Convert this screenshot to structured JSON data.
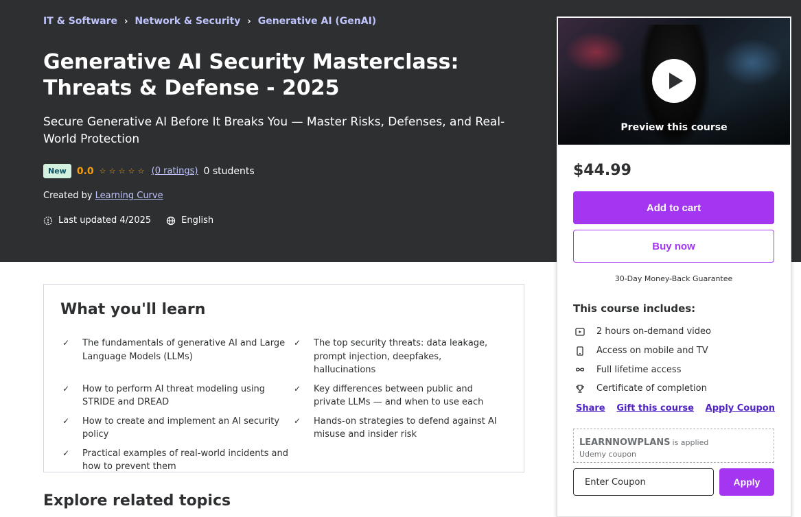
{
  "breadcrumb": [
    "IT & Software",
    "Network & Security",
    "Generative AI (GenAI)"
  ],
  "course": {
    "title": "Generative AI Security Masterclass: Threats & Defense - 2025",
    "subtitle": "Secure Generative AI Before It Breaks You — Master Risks, Defenses, and Real-World Protection",
    "badge": "New",
    "rating": "0.0",
    "ratings_count": "(0 ratings)",
    "students": "0 students",
    "created_by_label": "Created by",
    "author": "Learning Curve",
    "last_updated": "Last updated 4/2025",
    "language": "English"
  },
  "sidebar": {
    "preview_label": "Preview this course",
    "price": "$44.99",
    "add_to_cart": "Add to cart",
    "buy_now": "Buy now",
    "guarantee": "30-Day Money-Back Guarantee",
    "includes_title": "This course includes:",
    "includes": [
      {
        "icon": "video-icon",
        "text": "2 hours on-demand video"
      },
      {
        "icon": "mobile-icon",
        "text": "Access on mobile and TV"
      },
      {
        "icon": "infinity-icon",
        "text": "Full lifetime access"
      },
      {
        "icon": "trophy-icon",
        "text": "Certificate of completion"
      }
    ],
    "links": {
      "share": "Share",
      "gift": "Gift this course",
      "apply_coupon": "Apply Coupon"
    },
    "coupon": {
      "code": "LEARNNOWPLANS",
      "applied": "is applied",
      "sub": "Udemy coupon"
    },
    "coupon_input_placeholder": "Enter Coupon",
    "apply": "Apply"
  },
  "learn": {
    "title": "What you'll learn",
    "items": [
      "The fundamentals of generative AI and Large Language Models (LLMs)",
      "The top security threats: data leakage, prompt injection, deepfakes, hallucinations",
      "How to perform AI threat modeling using STRIDE and DREAD",
      "Key differences between public and private LLMs — and when to use each",
      "How to create and implement an AI security policy",
      "Hands-on strategies to defend against AI misuse and insider risk",
      "Practical examples of real-world incidents and how to prevent them"
    ]
  },
  "explore_title": "Explore related topics",
  "colors": {
    "hero_bg": "#2d2f31",
    "accent": "#a435f0",
    "link": "#c0c4fc",
    "star": "#f69c08"
  }
}
